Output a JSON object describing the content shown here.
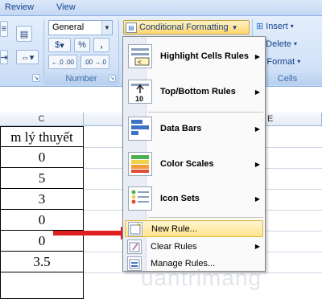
{
  "ribbon": {
    "tabs": [
      "Review",
      "View"
    ],
    "number_group": {
      "label": "Number",
      "format_value": "General",
      "currency": "$",
      "percent": "%",
      "comma": ",",
      "increase_decimal": "←.0 .00",
      "decrease_decimal": ".00 →.0"
    },
    "styles_group": {
      "conditional_formatting": "Conditional Formatting"
    },
    "cells_group": {
      "label": "Cells",
      "insert": "Insert",
      "delete": "Delete",
      "format": "Format"
    }
  },
  "sheet": {
    "columns": [
      "C",
      "E"
    ],
    "header_cell": "m lý thuyết",
    "cells": [
      "0",
      "5",
      "3",
      "0",
      "0",
      "3.5"
    ]
  },
  "menu": {
    "items": [
      {
        "label": "Highlight Cells Rules",
        "icon": "highlight-cells-icon"
      },
      {
        "label": "Top/Bottom Rules",
        "icon": "top-bottom-icon"
      },
      {
        "label": "Data Bars",
        "icon": "data-bars-icon"
      },
      {
        "label": "Color Scales",
        "icon": "color-scales-icon"
      },
      {
        "label": "Icon Sets",
        "icon": "icon-sets-icon"
      }
    ],
    "small_items": [
      {
        "label": "New Rule...",
        "icon": "new-rule-icon"
      },
      {
        "label": "Clear Rules",
        "icon": "clear-rules-icon"
      },
      {
        "label": "Manage Rules...",
        "icon": "manage-rules-icon"
      }
    ]
  },
  "colors": {
    "highlight": "#ffe48c",
    "arrow": "#e02020"
  },
  "watermark": "uantrimang"
}
